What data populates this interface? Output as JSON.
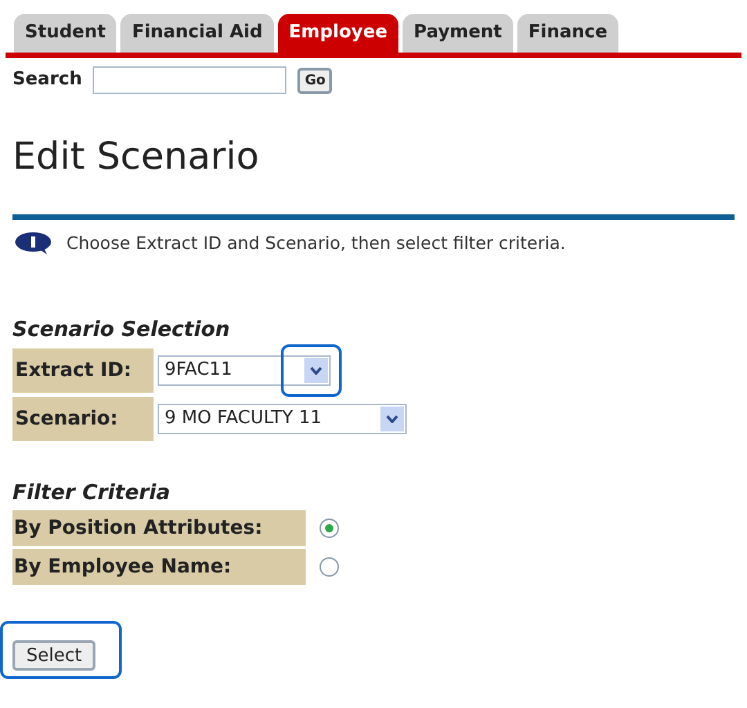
{
  "tabs": [
    {
      "label": "Student",
      "selected": false
    },
    {
      "label": "Financial Aid",
      "selected": false
    },
    {
      "label": "Employee",
      "selected": true
    },
    {
      "label": "Payment",
      "selected": false
    },
    {
      "label": "Finance",
      "selected": false
    }
  ],
  "search": {
    "label": "Search",
    "button": "Go"
  },
  "page_title": "Edit Scenario",
  "info_message": "Choose Extract ID and Scenario, then select filter criteria.",
  "scenario_selection": {
    "heading": "Scenario Selection",
    "fields": [
      {
        "label": "Extract ID:",
        "value": "9FAC11",
        "highlighted": true
      },
      {
        "label": "Scenario:",
        "value": "9 MO FACULTY 11",
        "highlighted": false
      }
    ]
  },
  "filter_criteria": {
    "heading": "Filter Criteria",
    "options": [
      {
        "label": "By Position Attributes:",
        "selected": true
      },
      {
        "label": "By Employee Name:",
        "selected": false
      }
    ]
  },
  "select_button": {
    "label": "Select",
    "highlighted": true
  }
}
